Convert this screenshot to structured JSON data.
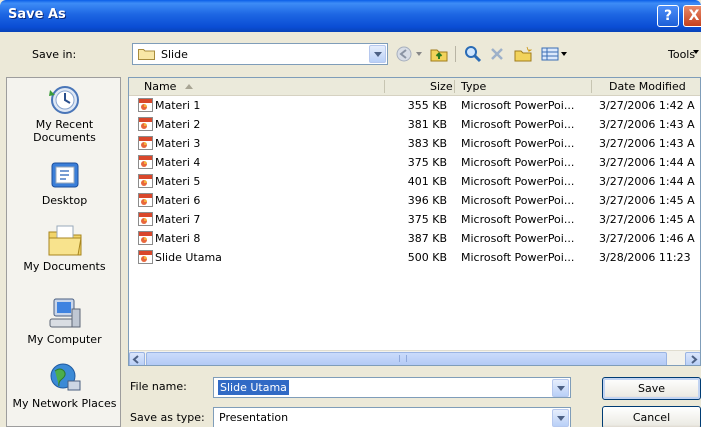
{
  "window": {
    "title": "Save As"
  },
  "title_buttons": {
    "help": "?",
    "close": "X"
  },
  "save_in": {
    "label": "Save in:",
    "value": "Slide"
  },
  "toolbar": {
    "tools_label": "Tools"
  },
  "places": [
    {
      "label": "My Recent Documents",
      "icon": "recent-documents-icon"
    },
    {
      "label": "Desktop",
      "icon": "desktop-icon"
    },
    {
      "label": "My Documents",
      "icon": "my-documents-icon"
    },
    {
      "label": "My Computer",
      "icon": "my-computer-icon"
    },
    {
      "label": "My Network Places",
      "icon": "network-places-icon"
    }
  ],
  "columns": {
    "name": "Name",
    "size": "Size",
    "type": "Type",
    "date": "Date Modified"
  },
  "files": [
    {
      "name": "Materi 1",
      "size": "355 KB",
      "type": "Microsoft PowerPoi...",
      "date": "3/27/2006 1:42 A"
    },
    {
      "name": "Materi 2",
      "size": "381 KB",
      "type": "Microsoft PowerPoi...",
      "date": "3/27/2006 1:43 A"
    },
    {
      "name": "Materi 3",
      "size": "383 KB",
      "type": "Microsoft PowerPoi...",
      "date": "3/27/2006 1:43 A"
    },
    {
      "name": "Materi 4",
      "size": "375 KB",
      "type": "Microsoft PowerPoi...",
      "date": "3/27/2006 1:44 A"
    },
    {
      "name": "Materi 5",
      "size": "401 KB",
      "type": "Microsoft PowerPoi...",
      "date": "3/27/2006 1:44 A"
    },
    {
      "name": "Materi 6",
      "size": "396 KB",
      "type": "Microsoft PowerPoi...",
      "date": "3/27/2006 1:45 A"
    },
    {
      "name": "Materi 7",
      "size": "375 KB",
      "type": "Microsoft PowerPoi...",
      "date": "3/27/2006 1:45 A"
    },
    {
      "name": "Materi 8",
      "size": "387 KB",
      "type": "Microsoft PowerPoi...",
      "date": "3/27/2006 1:46 A"
    },
    {
      "name": "Slide Utama",
      "size": "500 KB",
      "type": "Microsoft PowerPoi...",
      "date": "3/28/2006 11:23"
    }
  ],
  "file_name": {
    "label": "File name:",
    "value": "Slide Utama"
  },
  "save_as_type": {
    "label": "Save as type:",
    "value": "Presentation"
  },
  "buttons": {
    "save": "Save",
    "cancel": "Cancel"
  }
}
